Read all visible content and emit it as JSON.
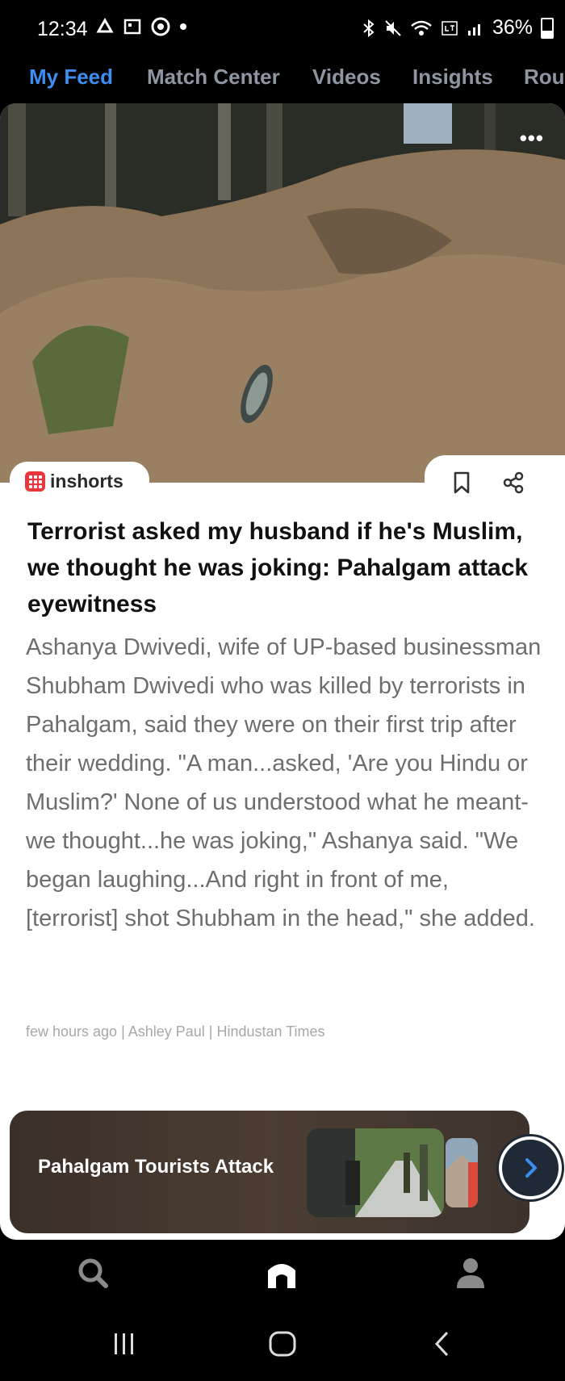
{
  "status_bar": {
    "time": "12:34",
    "battery": "36%",
    "battery_level": 0.36
  },
  "tabs": [
    {
      "label": "My Feed",
      "active": true
    },
    {
      "label": "Match Center",
      "active": false
    },
    {
      "label": "Videos",
      "active": false
    },
    {
      "label": "Insights",
      "active": false
    },
    {
      "label": "Rou",
      "active": false
    }
  ],
  "article": {
    "brand": "inshorts",
    "headline": "Terrorist asked my husband if he's Muslim, we thought he was joking: Pahalgam attack eyewitness",
    "body": "Ashanya Dwivedi, wife of UP-based businessman Shubham Dwivedi who was killed by terrorists in Pahalgam, said they were on their first trip after their wedding. \"A man...asked, 'Are you Hindu or Muslim?' None of us understood what he meant-we thought...he was joking,\" Ashanya said. \"We began laughing...And right in front of me, [terrorist] shot Shubham in the head,\" she added.",
    "meta": "few hours ago | Ashley Paul | Hindustan Times"
  },
  "topic_card": {
    "title": "Pahalgam Tourists Attack"
  },
  "icons": {
    "options": "more-options-icon",
    "bookmark": "bookmark-icon",
    "share": "share-icon",
    "next": "chevron-right-icon",
    "search": "search-icon",
    "home": "home-icon",
    "profile": "profile-icon"
  },
  "colors": {
    "accent": "#3d8ef2",
    "brand_red": "#e8383d",
    "tab_inactive": "#8e96a2",
    "body_text": "#6e6e6e"
  }
}
